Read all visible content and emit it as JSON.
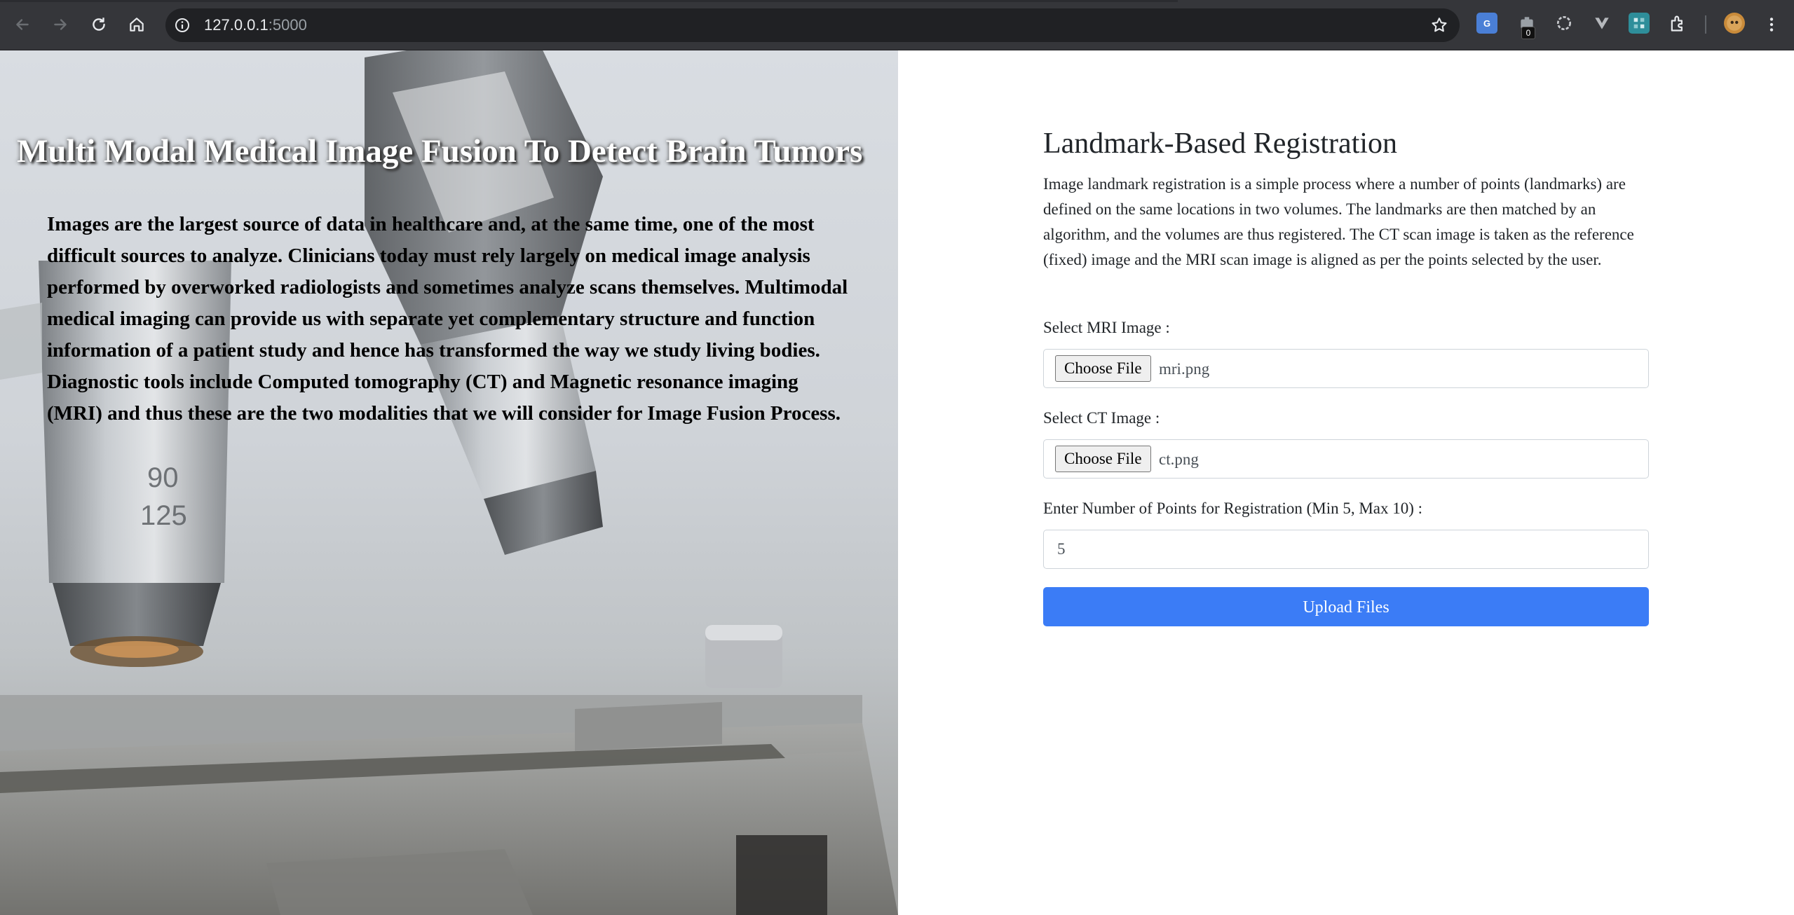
{
  "browser": {
    "url_host": "127.0.0.1",
    "url_port": ":5000",
    "extension_badge": "0"
  },
  "hero": {
    "title": "Multi Modal Medical Image Fusion To Detect Brain Tumors",
    "body": "Images are the largest source of data in healthcare and, at the same time, one of the most difficult sources to analyze. Clinicians today must rely largely on medical image analysis performed by overworked radiologists and sometimes analyze scans themselves. Multimodal medical imaging can provide us with separate yet complementary structure and function information of a patient study and hence has transformed the way we study living bodies. Diagnostic tools include Computed tomography (CT) and Magnetic resonance imaging (MRI) and thus these are the two modalities that we will consider for Image Fusion Process.",
    "lens_marks": [
      "90",
      "125"
    ]
  },
  "form": {
    "heading": "Landmark-Based Registration",
    "description": "Image landmark registration is a simple process where a number of points (landmarks) are defined on the same locations in two volumes. The landmarks are then matched by an algorithm, and the volumes are thus registered. The CT scan image is taken as the reference (fixed) image and the MRI scan image is aligned as per the points selected by the user.",
    "mri_label": "Select MRI Image :",
    "mri_button": "Choose File",
    "mri_file": "mri.png",
    "ct_label": "Select CT Image :",
    "ct_button": "Choose File",
    "ct_file": "ct.png",
    "points_label": "Enter Number of Points for Registration (Min 5, Max 10) :",
    "points_value": "5",
    "submit_label": "Upload Files"
  },
  "colors": {
    "accent": "#3b7cf6",
    "chrome_bg": "#35363a",
    "omnibox_bg": "#202124"
  }
}
